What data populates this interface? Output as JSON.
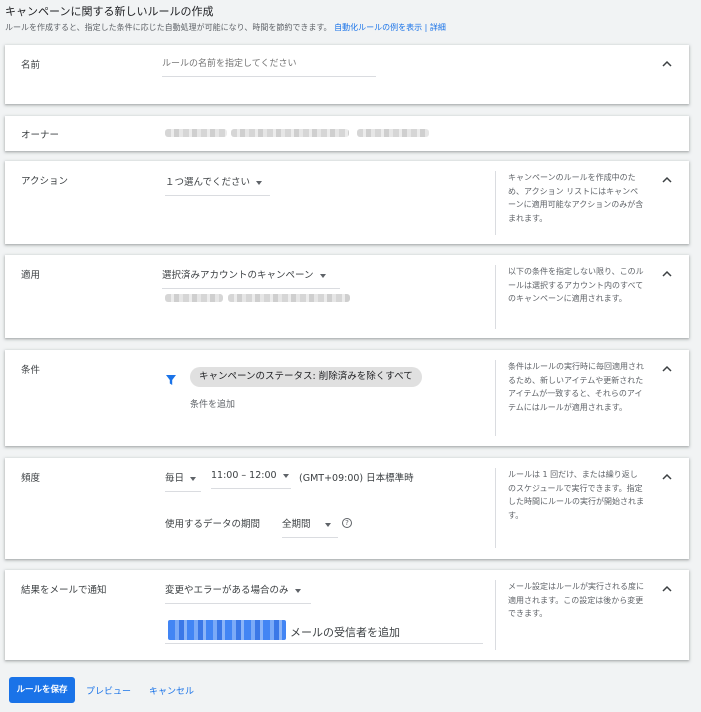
{
  "header": {
    "title": "キャンペーンに関する新しいルールの作成",
    "description": "ルールを作成すると、指定した条件に応じた自動処理が可能になり、時間を節約できます。",
    "examples_link": "自動化ルールの例を表示",
    "separator": "|",
    "details_link": "詳細"
  },
  "name_section": {
    "label": "名前",
    "placeholder": "ルールの名前を指定してください"
  },
  "owner_section": {
    "label": "オーナー"
  },
  "action_section": {
    "label": "アクション",
    "select_value": "１つ選んでください",
    "help": "キャンペーンのルールを作成中のため、アクション リストにはキャンペーンに適用可能なアクションのみが含まれます。"
  },
  "apply_section": {
    "label": "適用",
    "select_value": "選択済みアカウントのキャンペーン",
    "help": "以下の条件を指定しない限り、このルールは選択するアカウント内のすべてのキャンペーンに適用されます。"
  },
  "condition_section": {
    "label": "条件",
    "chip": "キャンペーンのステータス: 削除済みを除くすべて",
    "add_link": "条件を追加",
    "help": "条件はルールの実行時に毎回適用されるため、新しいアイテムや更新されたアイテムが一致すると、それらのアイテムにはルールが適用されます。"
  },
  "frequency_section": {
    "label": "頻度",
    "frequency_value": "毎日",
    "time_value": "11:00 – 12:00",
    "timezone": "(GMT+09:00) 日本標準時",
    "data_period_label": "使用するデータの期間",
    "data_period_value": "全期間",
    "help_icon": "?",
    "help": "ルールは 1 回だけ、または繰り返しのスケジュールで実行できます。指定した時間にルールの実行が開始されます。"
  },
  "email_section": {
    "label": "結果をメールで通知",
    "select_value": "変更やエラーがある場合のみ",
    "add_recipient_placeholder": "メールの受信者を追加",
    "help": "メール設定はルールが実行される度に適用されます。この設定は後から変更できます。"
  },
  "footer": {
    "save_label": "ルールを保存",
    "preview_label": "プレビュー",
    "cancel_label": "キャンセル"
  },
  "colors": {
    "accent": "#1a73e8",
    "filter_icon": "#1a73e8",
    "chip_bg": "#e0e0e0",
    "page_bg": "#f1f3f4"
  },
  "icons": {
    "collapse": "chevron-up-icon",
    "filter": "filter-icon",
    "dropdown": "caret-down-icon",
    "help": "help-circle-icon"
  }
}
